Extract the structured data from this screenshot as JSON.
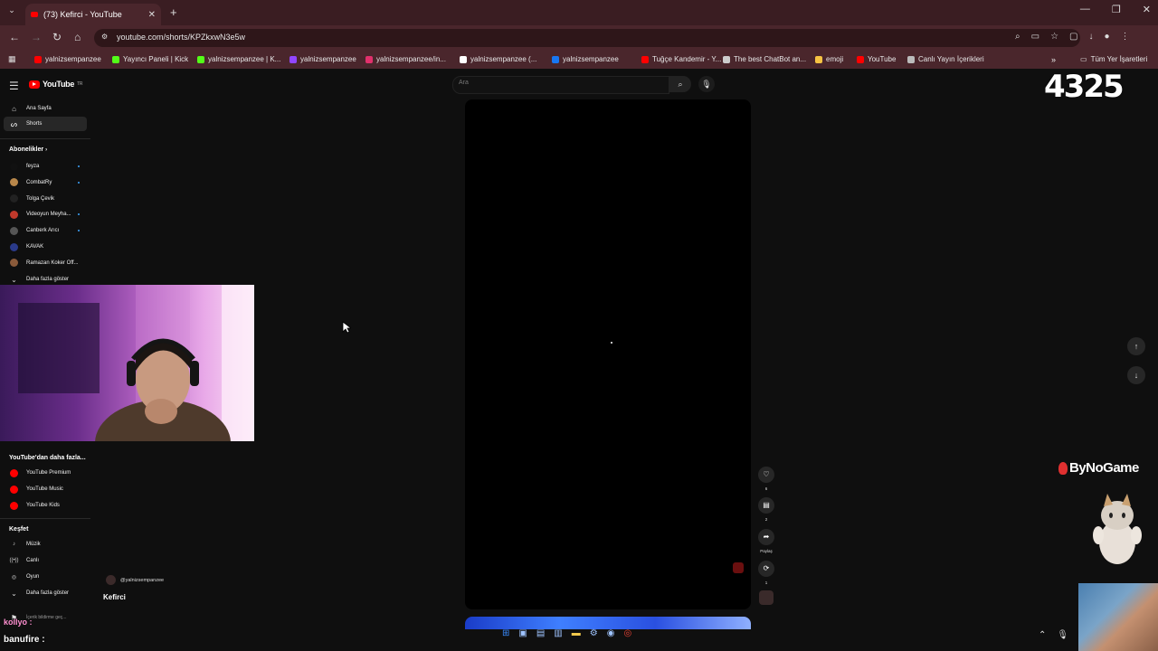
{
  "browser": {
    "tab_title": "(73) Kefirci - YouTube",
    "new_tab": "+",
    "url": "youtube.com/shorts/KPZkxwN3e5w",
    "bookmarks": [
      {
        "label": "yalnizsempanzee",
        "color": "#ff0000"
      },
      {
        "label": "Yayıncı Paneli | Kick",
        "color": "#53fc18"
      },
      {
        "label": "yalnizsempanzee | K...",
        "color": "#53fc18"
      },
      {
        "label": "yalnizsempanzee",
        "color": "#9146ff"
      },
      {
        "label": "yalnizsempanzee/in...",
        "color": "#e1306c"
      },
      {
        "label": "yalnizsempanzee (...",
        "color": "#ffffff"
      },
      {
        "label": "yalnizsempanzee",
        "color": "#1877f2"
      },
      {
        "label": "Tuğçe Kandemir - Y...",
        "color": "#ff0000"
      },
      {
        "label": "The best ChatBot an...",
        "color": "#cccccc"
      },
      {
        "label": "emoji",
        "color": "#f6c343"
      },
      {
        "label": "YouTube",
        "color": "#ff0000"
      },
      {
        "label": "Canlı Yayın İçerikleri",
        "color": "#bbbbbb"
      }
    ],
    "all_bookmarks": "Tüm Yer İşaretleri"
  },
  "youtube": {
    "logo": "YouTube",
    "logo_region": "TR",
    "search_placeholder": "Ara",
    "sidebar": {
      "main": [
        {
          "label": "Ana Sayfa",
          "icon": "home-icon"
        },
        {
          "label": "Shorts",
          "icon": "shorts-icon"
        }
      ],
      "subscriptions_header": "Abonelikler",
      "subscriptions": [
        {
          "label": "feyza",
          "color": "#111111",
          "dot": true
        },
        {
          "label": "CombatRy",
          "color": "#b8874a",
          "dot": true
        },
        {
          "label": "Tolga Çevik",
          "color": "#222222",
          "dot": false
        },
        {
          "label": "Videoyun Meyha...",
          "color": "#c0392b",
          "dot": true
        },
        {
          "label": "Canberk Arıcı",
          "color": "#555555",
          "dot": true
        },
        {
          "label": "KAVAK",
          "color": "#2a3a8a",
          "dot": false
        },
        {
          "label": "Ramazan Koker Off...",
          "color": "#8a5a3a",
          "dot": false
        }
      ],
      "show_more": "Daha fazla göster",
      "more_from_header": "YouTube'dan daha fazla...",
      "more_from": [
        {
          "label": "YouTube Premium",
          "color": "#ff0000"
        },
        {
          "label": "YouTube Music",
          "color": "#ff0000"
        },
        {
          "label": "YouTube Kids",
          "color": "#ff0000"
        }
      ],
      "explore_header": "Keşfet",
      "explore": [
        {
          "label": "Müzik",
          "icon": "music-icon"
        },
        {
          "label": "Canlı",
          "icon": "live-icon"
        },
        {
          "label": "Oyun",
          "icon": "gaming-icon"
        }
      ],
      "show_more_2": "Daha fazla göster",
      "footer_partial": "İçerik bildirme geç..."
    },
    "short": {
      "channel": "@yalnizsempanzee",
      "title": "Kefirci",
      "likes": "6",
      "comments": "2",
      "share": "Paylaş",
      "remix": "1"
    }
  },
  "overlay": {
    "counter": "4325",
    "sponsor": "ByNoGame",
    "chat_top": "kollyo :",
    "chat_line": "banufire :"
  }
}
